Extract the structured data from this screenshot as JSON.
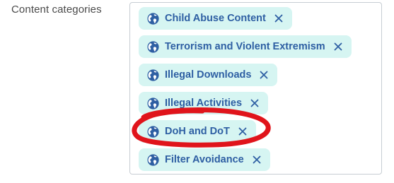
{
  "field": {
    "label": "Content categories"
  },
  "chips": [
    {
      "label": "Child Abuse Content",
      "icon": "globe-icon",
      "remove_icon": "close-icon"
    },
    {
      "label": "Terrorism and Violent Extremism",
      "icon": "globe-icon",
      "remove_icon": "close-icon"
    },
    {
      "label": "Illegal Downloads",
      "icon": "globe-icon",
      "remove_icon": "close-icon"
    },
    {
      "label": "Illegal Activities",
      "icon": "globe-icon",
      "remove_icon": "close-icon"
    },
    {
      "label": "DoH and DoT",
      "icon": "globe-icon",
      "remove_icon": "close-icon"
    },
    {
      "label": "Filter Avoidance",
      "icon": "globe-icon",
      "remove_icon": "close-icon"
    }
  ],
  "colors": {
    "chip_background": "#d6f5f2",
    "chip_text": "#2e5fa3",
    "annotation": "#e0141b"
  }
}
